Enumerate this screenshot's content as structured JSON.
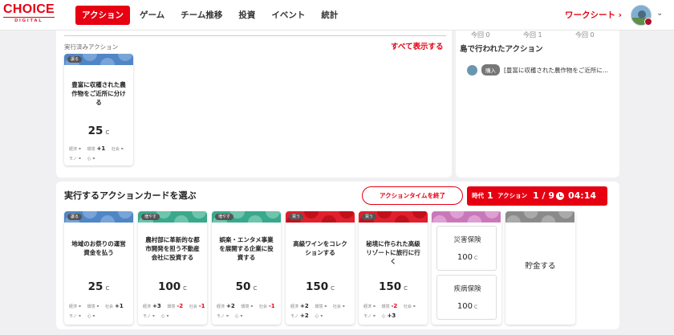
{
  "header": {
    "logo_main": "CHOICE",
    "logo_sub": "DIGITAL",
    "nav": [
      "アクション",
      "ゲーム",
      "チーム推移",
      "投資",
      "イベント",
      "統計"
    ],
    "active_index": 0,
    "worksheet": "ワークシート",
    "worksheet_arrow": "›",
    "avatar_caret": "⌄"
  },
  "top_panel": {
    "done_label": "実行済みアクション",
    "show_all": "すべて表示する",
    "done_card": {
      "chip": "譲る",
      "name": "豊富に収穫された農作物をご近所に分ける",
      "cost": "25",
      "unit": "C",
      "stats_row1": [
        {
          "label": "経済",
          "value": "-"
        },
        {
          "label": "環境",
          "value": "+1"
        },
        {
          "label": "社会",
          "value": "-"
        }
      ],
      "stats_row2": [
        {
          "label": "モノ",
          "value": "-"
        },
        {
          "label": "心",
          "value": "-"
        }
      ]
    }
  },
  "right_panel": {
    "today_labels": [
      "今回 0",
      "今回 1",
      "今回 0"
    ],
    "island_title": "島で行われたアクション",
    "island_item": {
      "chip": "購入",
      "text": "[豊富に収穫された農作物をご近所に..."
    }
  },
  "bottom_panel": {
    "title": "実行するアクションカードを選ぶ",
    "end_button": "アクションタイムを終了",
    "status": {
      "era_label": "時代",
      "era_value": "1",
      "action_label": "アクション",
      "action_value": "1 / 9",
      "timer": "04:14"
    },
    "cards": [
      {
        "chip": "譲る",
        "name": "地域のお祭りの運営資金を払う",
        "cost": "25",
        "unit": "C",
        "theme": "blue",
        "stats_row1": [
          {
            "label": "経済",
            "value": "-"
          },
          {
            "label": "環境",
            "value": "-"
          },
          {
            "label": "社会",
            "value": "+1"
          }
        ],
        "stats_row2": [
          {
            "label": "モノ",
            "value": "-"
          },
          {
            "label": "心",
            "value": "-"
          }
        ]
      },
      {
        "chip": "増やす",
        "name": "農村部に革新的な都市開発を担う不動産会社に投資する",
        "cost": "100",
        "unit": "C",
        "theme": "green",
        "stats_row1": [
          {
            "label": "経済",
            "value": "+3"
          },
          {
            "label": "環境",
            "value": "-2"
          },
          {
            "label": "社会",
            "value": "-1"
          }
        ],
        "stats_row2": [
          {
            "label": "モノ",
            "value": "-"
          },
          {
            "label": "心",
            "value": "-"
          }
        ]
      },
      {
        "chip": "増やす",
        "name": "娯楽・エンタメ事業を展開する企業に投資する",
        "cost": "50",
        "unit": "C",
        "theme": "green",
        "stats_row1": [
          {
            "label": "経済",
            "value": "+2"
          },
          {
            "label": "環境",
            "value": "-"
          },
          {
            "label": "社会",
            "value": "-1"
          }
        ],
        "stats_row2": [
          {
            "label": "モノ",
            "value": "-"
          },
          {
            "label": "心",
            "value": "-"
          }
        ]
      },
      {
        "chip": "買う",
        "name": "高級ワインをコレクションする",
        "cost": "150",
        "unit": "C",
        "theme": "red",
        "stats_row1": [
          {
            "label": "経済",
            "value": "+2"
          },
          {
            "label": "環境",
            "value": "-"
          },
          {
            "label": "社会",
            "value": "-"
          }
        ],
        "stats_row2": [
          {
            "label": "モノ",
            "value": "+2"
          },
          {
            "label": "心",
            "value": "-"
          }
        ]
      },
      {
        "chip": "買う",
        "name": "秘境に作られた高級リゾートに旅行に行く",
        "cost": "150",
        "unit": "C",
        "theme": "red",
        "stats_row1": [
          {
            "label": "経済",
            "value": "-"
          },
          {
            "label": "環境",
            "value": "-2"
          },
          {
            "label": "社会",
            "value": "-"
          }
        ],
        "stats_row2": [
          {
            "label": "モノ",
            "value": "-"
          },
          {
            "label": "心",
            "value": "+3"
          }
        ]
      }
    ],
    "insurance": [
      {
        "label": "災害保険",
        "cost": "100",
        "unit": "C"
      },
      {
        "label": "疾病保険",
        "cost": "100",
        "unit": "C"
      }
    ],
    "savings": "貯金する"
  },
  "colors": {
    "brand": "#e60012",
    "blue": "#4f86c6",
    "green": "#3aa88c",
    "red": "#e0202c",
    "pink": "#c878b8",
    "gray": "#8a8a8a"
  }
}
